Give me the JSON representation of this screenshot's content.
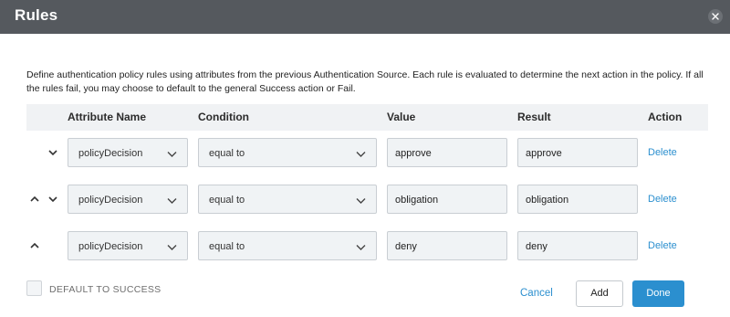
{
  "dialog": {
    "title": "Rules",
    "description": "Define authentication policy rules using attributes from the previous Authentication Source. Each rule is evaluated to determine the next action in the policy. If all the rules fail, you may choose to default to the general Success action or Fail."
  },
  "table": {
    "headers": {
      "attribute": "Attribute Name",
      "condition": "Condition",
      "value": "Value",
      "result": "Result",
      "action": "Action"
    },
    "rows": [
      {
        "attribute": "policyDecision",
        "condition": "equal to",
        "value": "approve",
        "result": "approve",
        "action": "Delete",
        "arrows": [
          "down"
        ]
      },
      {
        "attribute": "policyDecision",
        "condition": "equal to",
        "value": "obligation",
        "result": "obligation",
        "action": "Delete",
        "arrows": [
          "up",
          "down"
        ]
      },
      {
        "attribute": "policyDecision",
        "condition": "equal to",
        "value": "deny",
        "result": "deny",
        "action": "Delete",
        "arrows": [
          "up"
        ]
      }
    ]
  },
  "footer": {
    "default_label": "DEFAULT TO SUCCESS",
    "default_checked": false,
    "cancel_label": "Cancel",
    "add_label": "Add",
    "done_label": "Done"
  },
  "colors": {
    "header_bg": "#55595e",
    "accent": "#2b8fcf",
    "field_bg": "#f0f3f5"
  }
}
